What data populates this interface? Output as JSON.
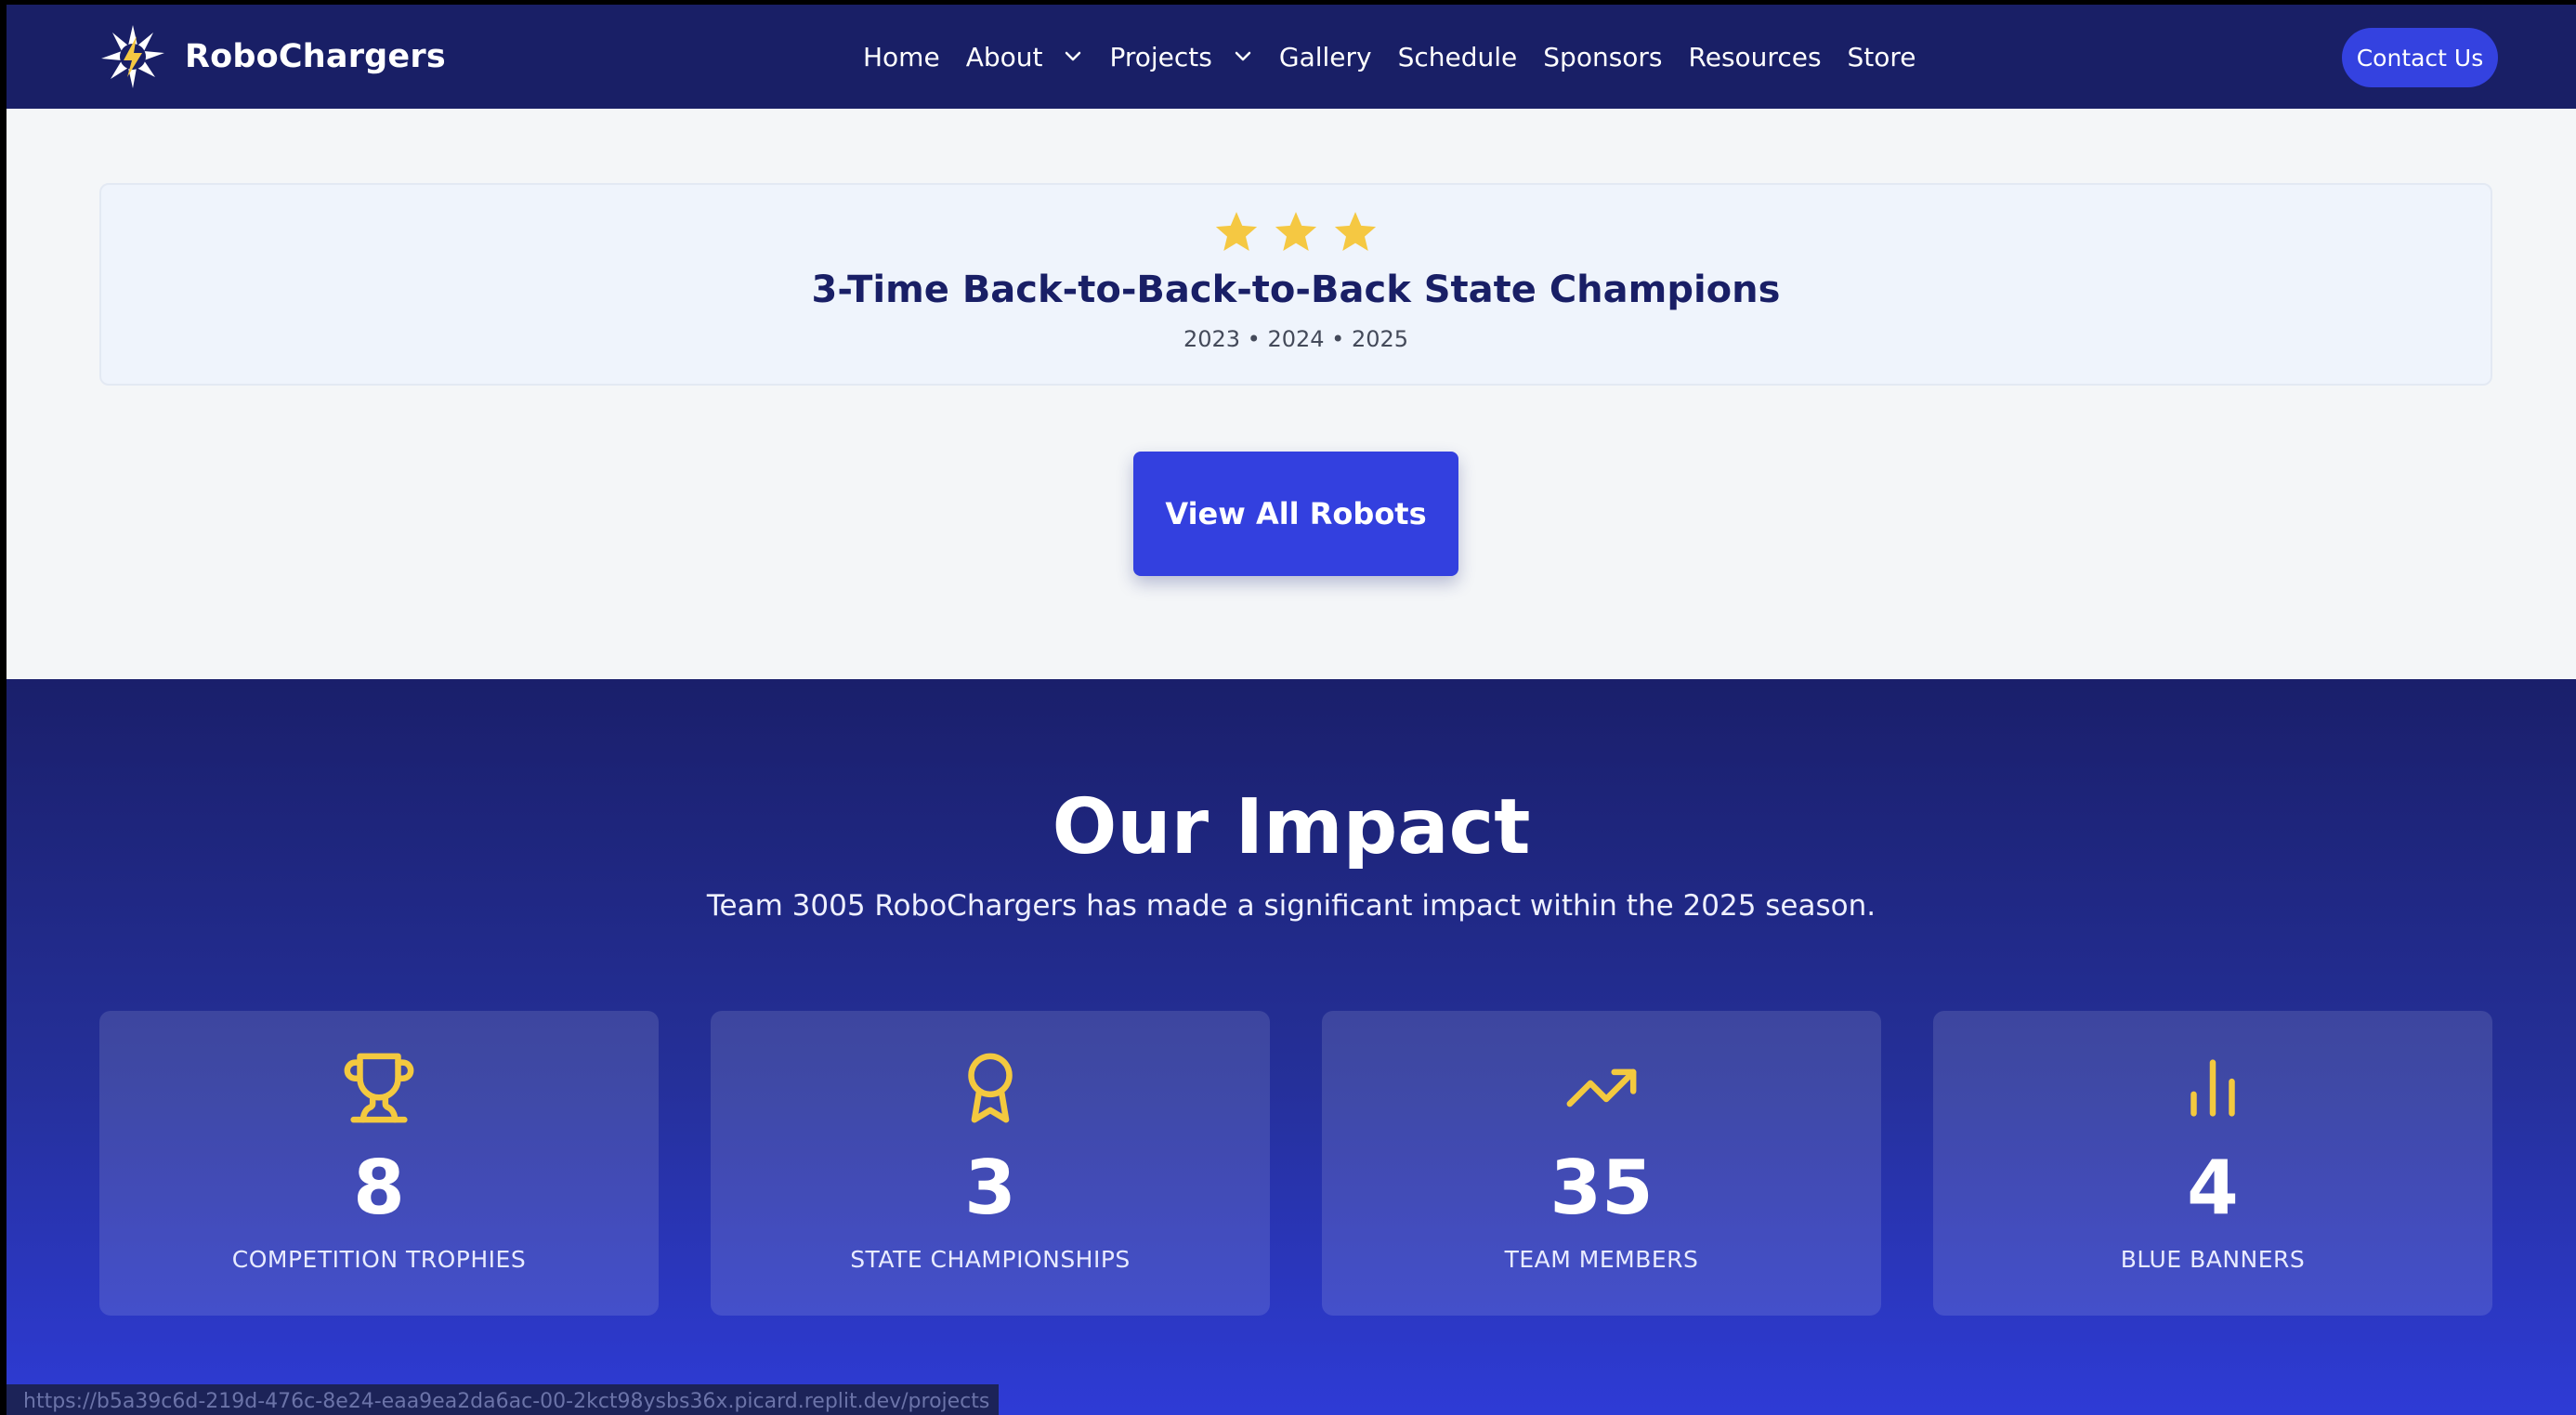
{
  "brand": {
    "name": "RoboChargers",
    "logo_icon": "lightning-star-logo"
  },
  "nav": {
    "items": [
      {
        "label": "Home",
        "has_dropdown": false
      },
      {
        "label": "About",
        "has_dropdown": true
      },
      {
        "label": "Projects",
        "has_dropdown": true
      },
      {
        "label": "Gallery",
        "has_dropdown": false
      },
      {
        "label": "Schedule",
        "has_dropdown": false
      },
      {
        "label": "Sponsors",
        "has_dropdown": false
      },
      {
        "label": "Resources",
        "has_dropdown": false
      },
      {
        "label": "Store",
        "has_dropdown": false
      }
    ],
    "contact_label": "Contact Us"
  },
  "championship": {
    "stars": 3,
    "title": "3-Time Back-to-Back-to-Back State Champions",
    "years": "2023 • 2024 • 2025"
  },
  "view_robots_label": "View All Robots",
  "impact": {
    "title": "Our Impact",
    "subtitle": "Team 3005 RoboChargers has made a significant impact within the 2025 season.",
    "stats": [
      {
        "icon": "trophy-icon",
        "value": "8",
        "label": "COMPETITION TROPHIES"
      },
      {
        "icon": "award-ribbon-icon",
        "value": "3",
        "label": "STATE CHAMPIONSHIPS"
      },
      {
        "icon": "trending-up-icon",
        "value": "35",
        "label": "TEAM MEMBERS"
      },
      {
        "icon": "bar-chart-icon",
        "value": "4",
        "label": "BLUE BANNERS"
      }
    ]
  },
  "status_bar": {
    "url": "https://b5a39c6d-219d-476c-8e24-eaa9ea2da6ac-00-2kct98ysbs36x.picard.replit.dev/projects"
  },
  "colors": {
    "nav_bg": "#191f66",
    "accent_blue": "#3340df",
    "star_yellow": "#f5c842",
    "icon_yellow": "#f3c93f",
    "title_navy": "#191f66"
  }
}
